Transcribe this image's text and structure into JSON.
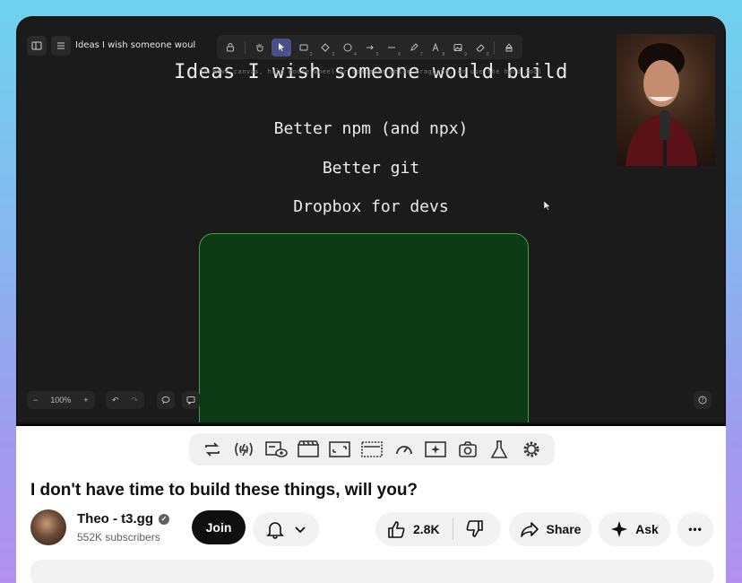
{
  "canvas": {
    "doc_title": "Ideas I wish someone woul",
    "heading": "Ideas I wish someone would build",
    "hint_text": "To move canvas, hold mouse wheel or spacebar while dragging, or use the hand tool",
    "items": [
      "Better npm (and npx)",
      "Better git",
      "Dropbox for devs"
    ],
    "zoom_label": "100%",
    "toolbar": [
      {
        "icon": "lock-icon",
        "key": ""
      },
      {
        "icon": "hand-icon",
        "key": ""
      },
      {
        "icon": "pointer-icon",
        "key": "1",
        "active": true
      },
      {
        "icon": "rectangle-icon",
        "key": "2"
      },
      {
        "icon": "diamond-icon",
        "key": "3"
      },
      {
        "icon": "ellipse-icon",
        "key": "4"
      },
      {
        "icon": "arrow-icon",
        "key": "5"
      },
      {
        "icon": "line-icon",
        "key": "6"
      },
      {
        "icon": "pencil-icon",
        "key": "7"
      },
      {
        "icon": "text-icon",
        "key": "8"
      },
      {
        "icon": "image-icon",
        "key": "9"
      },
      {
        "icon": "eraser-icon",
        "key": "0"
      },
      {
        "icon": "library-icon",
        "key": ""
      }
    ]
  },
  "player_extensions": [
    "loop-icon",
    "audio-icon",
    "watch-later-icon",
    "clapper-icon",
    "aspect-icon",
    "theater-icon",
    "speed-icon",
    "sparkle-icon",
    "screenshot-icon",
    "flask-icon",
    "settings-icon"
  ],
  "video": {
    "title": "I don't have time to build these things, will you?"
  },
  "channel": {
    "name": "Theo - t3.gg",
    "verified_mark": "✓",
    "subscribers": "552K subscribers",
    "join_label": "Join"
  },
  "actions": {
    "like_count": "2.8K",
    "share_label": "Share",
    "ask_label": "Ask",
    "more_label": "•••"
  },
  "colors": {
    "canvas_bg": "#1b1b1b",
    "green_box": "#0b3a14",
    "green_border": "#3ea53e",
    "toolbar_active": "#4a4f8a",
    "join_bg": "#0f0f0f"
  }
}
